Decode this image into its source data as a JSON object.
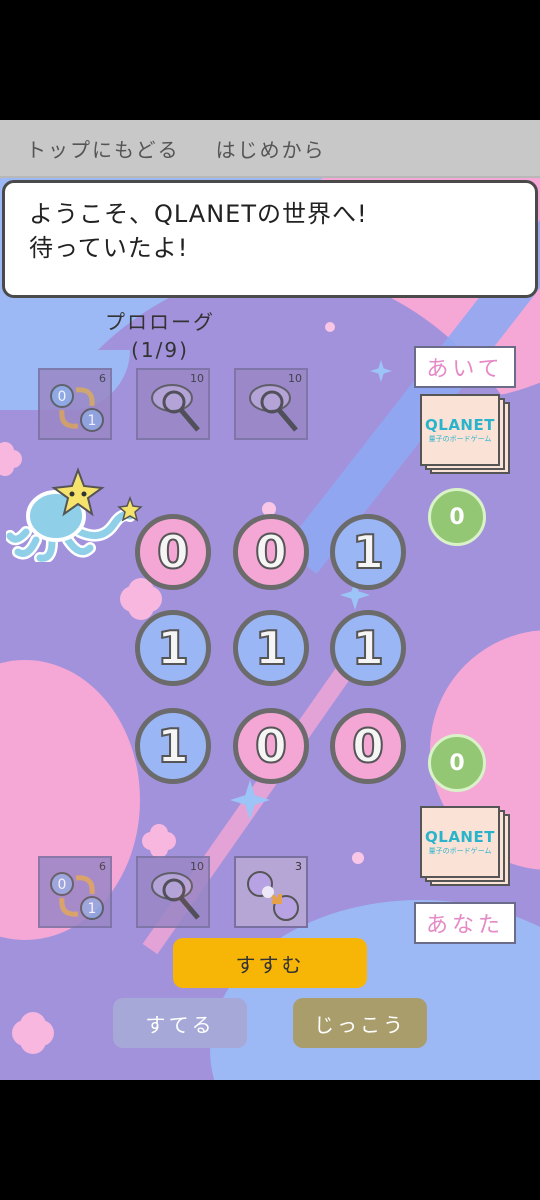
{
  "top_bar": {
    "back_to_top": "トップにもどる",
    "restart": "はじめから"
  },
  "dialog": {
    "line1": "ようこそ、QLANETの世界へ!",
    "line2": "待っていたよ!"
  },
  "stage": {
    "name": "プロローグ",
    "progress": "(1/9)"
  },
  "opponent": {
    "label": "あいて",
    "score": "0",
    "deck_logo": "QLANET",
    "deck_sub": "量子のボードゲーム",
    "skills": [
      {
        "icon": "swap-icon",
        "count": "6"
      },
      {
        "icon": "magnifier-icon",
        "count": "10"
      },
      {
        "icon": "magnifier-icon",
        "count": "10"
      }
    ]
  },
  "player": {
    "label": "あなた",
    "score": "0",
    "deck_logo": "QLANET",
    "deck_sub": "量子のボードゲーム",
    "skills": [
      {
        "icon": "swap-icon",
        "count": "6"
      },
      {
        "icon": "magnifier-icon",
        "count": "10"
      },
      {
        "icon": "exchange-icon",
        "count": "3"
      }
    ]
  },
  "board": [
    [
      {
        "value": "0",
        "color": "pink"
      },
      {
        "value": "0",
        "color": "pink"
      },
      {
        "value": "1",
        "color": "blue"
      }
    ],
    [
      {
        "value": "1",
        "color": "blue"
      },
      {
        "value": "1",
        "color": "blue"
      },
      {
        "value": "1",
        "color": "blue"
      }
    ],
    [
      {
        "value": "1",
        "color": "blue"
      },
      {
        "value": "0",
        "color": "pink"
      },
      {
        "value": "0",
        "color": "pink"
      }
    ]
  ],
  "buttons": {
    "next": "すすむ",
    "discard": "すてる",
    "run": "じっこう"
  },
  "colors": {
    "pink": "#f4a6d4",
    "blue": "#9bb6f4",
    "accent": "#f7b505",
    "score": "#93c774"
  }
}
